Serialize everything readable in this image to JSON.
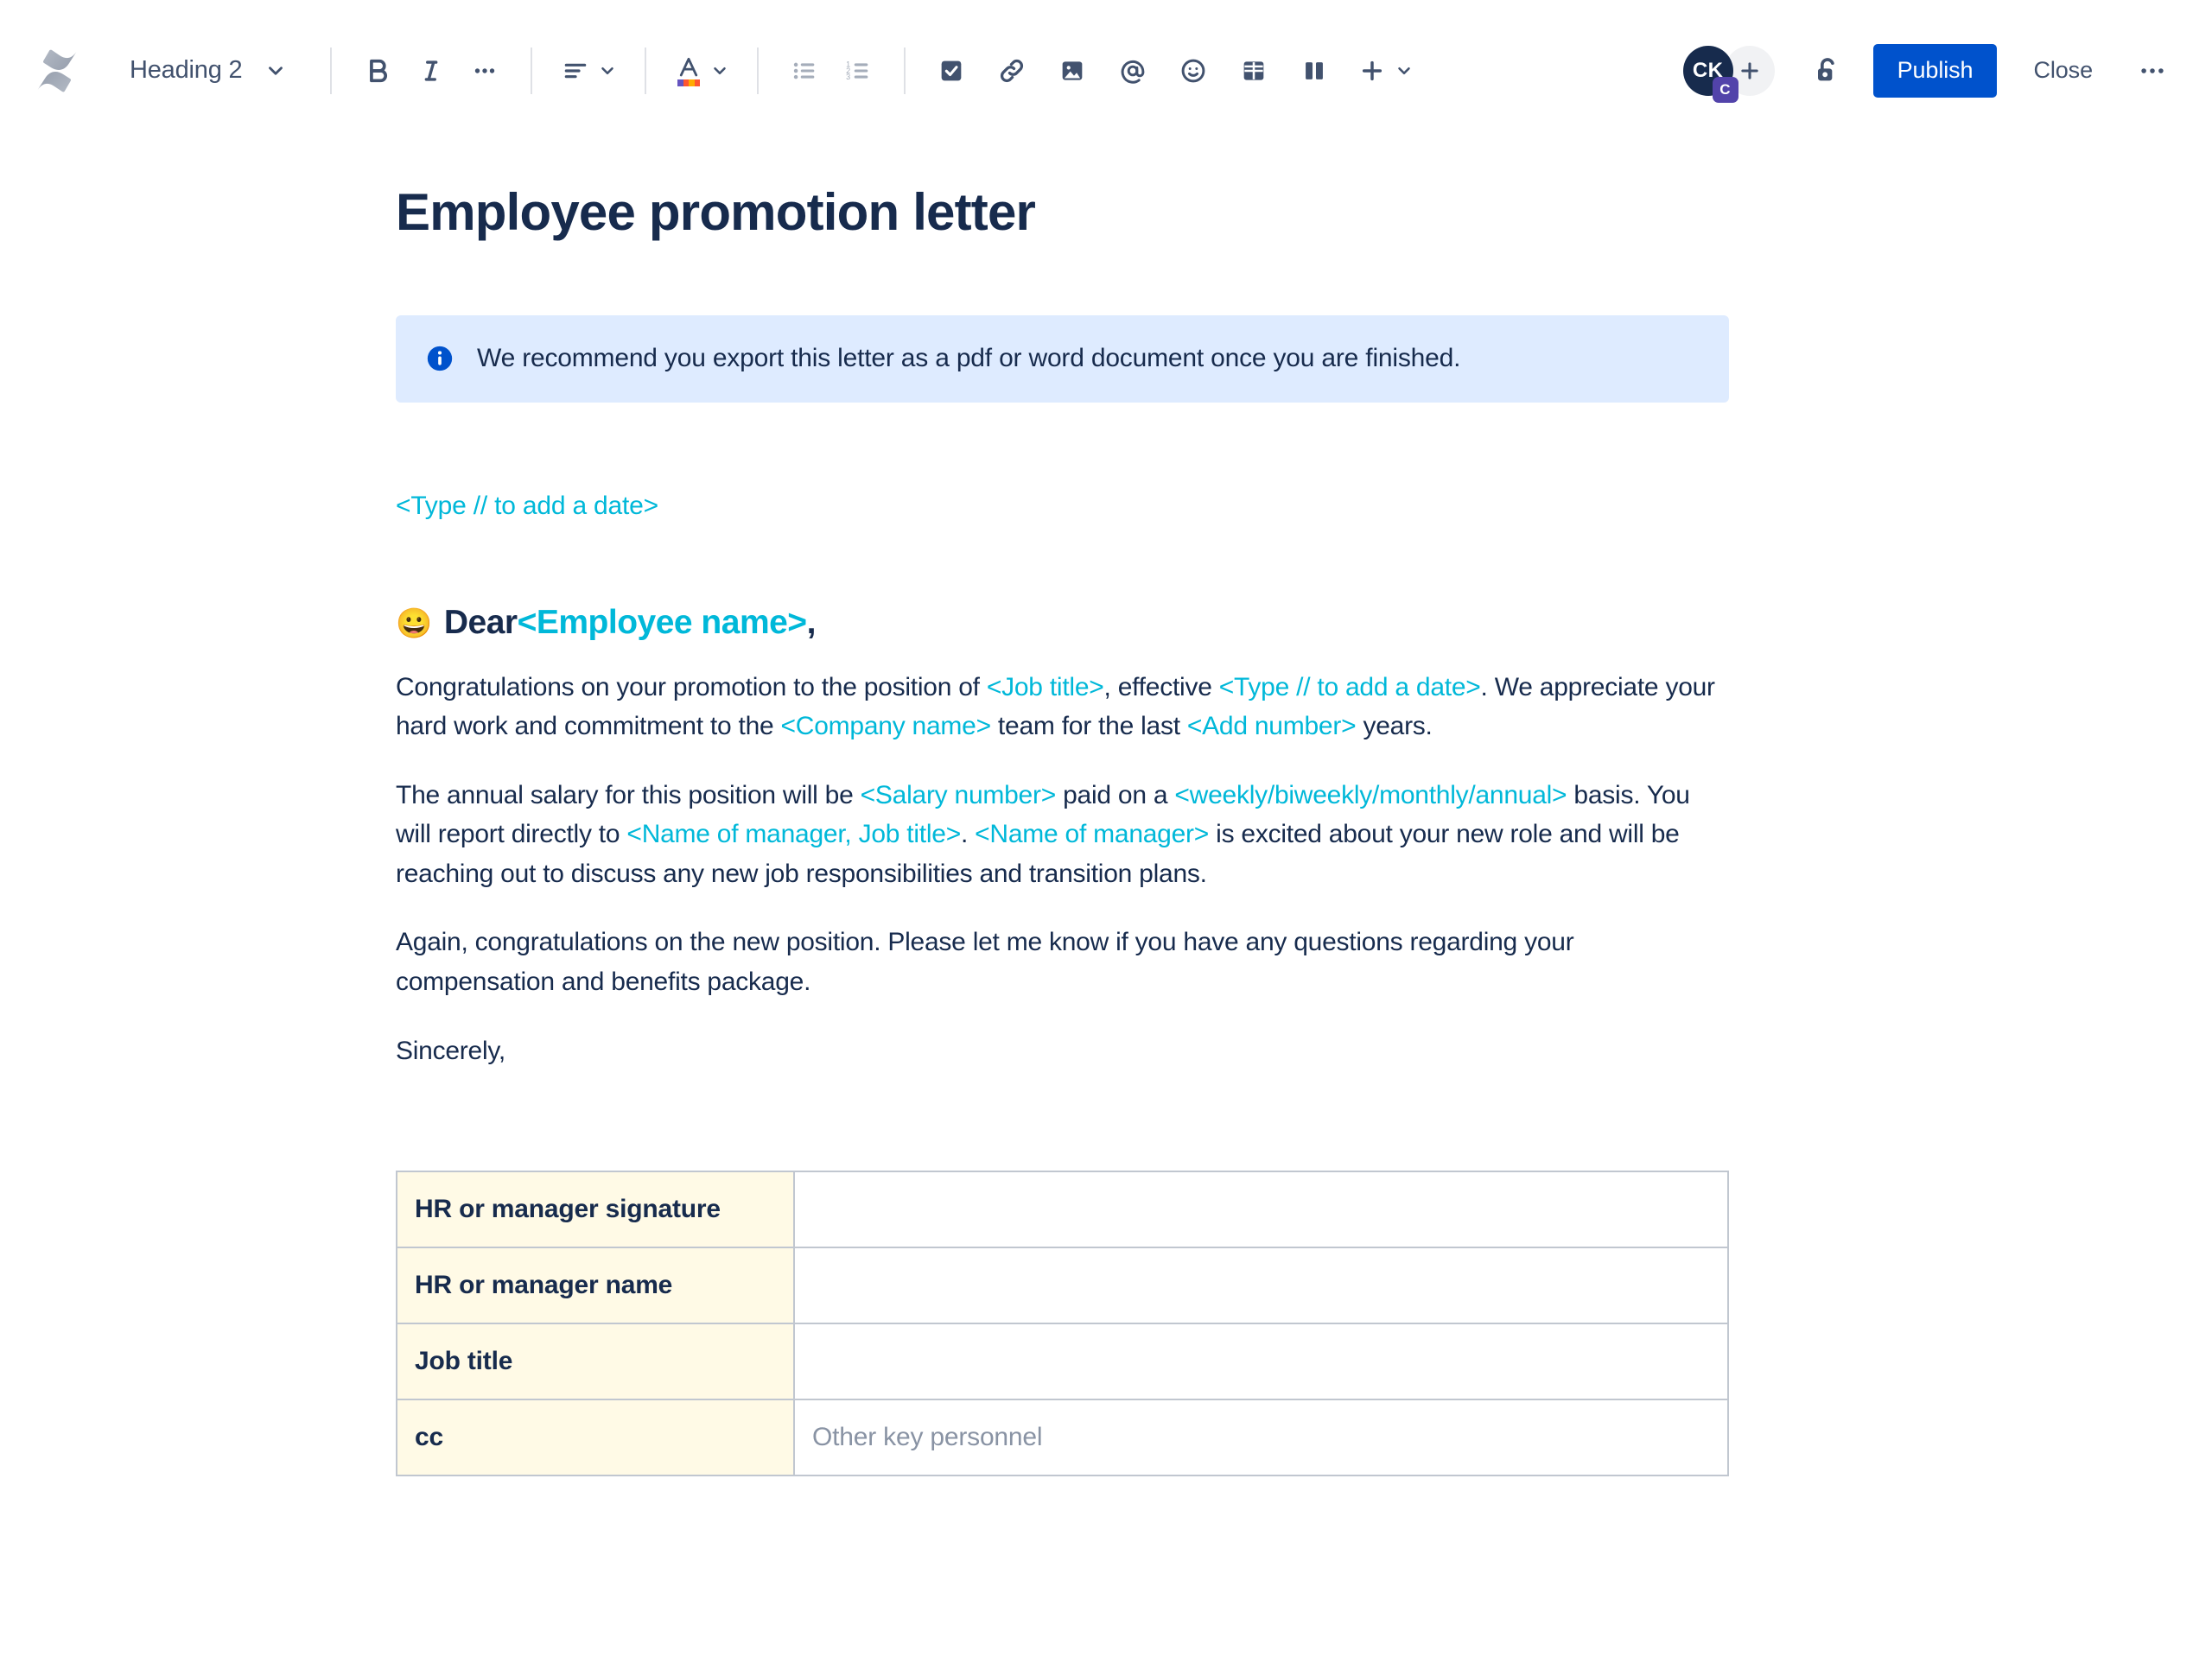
{
  "app": {
    "name": "Confluence",
    "logo_icon": "confluence-logo-icon"
  },
  "toolbar": {
    "block_type": {
      "label": "Heading 2",
      "chevron_icon": "chevron-down-icon"
    },
    "buttons": [
      {
        "name": "bold",
        "icon": "bold-icon",
        "label": "B"
      },
      {
        "name": "italic",
        "icon": "italic-icon",
        "label": "I"
      },
      {
        "name": "more-formatting",
        "icon": "ellipsis-icon",
        "label": "•••"
      },
      {
        "name": "text-align",
        "icon": "text-align-icon",
        "label": ""
      },
      {
        "name": "text-color",
        "icon": "text-color-icon",
        "label": "A"
      },
      {
        "name": "bulleted-list",
        "icon": "bulleted-list-icon",
        "label": ""
      },
      {
        "name": "numbered-list",
        "icon": "numbered-list-icon",
        "label": ""
      },
      {
        "name": "task-list",
        "icon": "checkbox-icon",
        "label": ""
      },
      {
        "name": "link",
        "icon": "link-icon",
        "label": ""
      },
      {
        "name": "image",
        "icon": "image-icon",
        "label": ""
      },
      {
        "name": "mention",
        "icon": "mention-at-icon",
        "label": "@"
      },
      {
        "name": "emoji",
        "icon": "emoji-smiley-icon",
        "label": ""
      },
      {
        "name": "table",
        "icon": "table-icon",
        "label": ""
      },
      {
        "name": "layout",
        "icon": "two-column-layout-icon",
        "label": ""
      },
      {
        "name": "insert-more",
        "icon": "plus-icon",
        "label": "+"
      }
    ],
    "avatar": {
      "initials": "CK",
      "badge": "C",
      "add_icon": "plus-icon"
    },
    "restrictions_icon": "unlocked-padlock-icon",
    "publish_label": "Publish",
    "close_label": "Close",
    "more_actions_icon": "ellipsis-icon",
    "more_actions_label": "•••"
  },
  "colors": {
    "accent_blue": "#0052CC",
    "placeholder_teal": "#00B8D9",
    "info_panel_bg": "#DEEBFF",
    "table_header_bg": "#FFFAE6",
    "text_navy": "#172B4D",
    "muted_gray": "#8993A4",
    "avatar_navy": "#172B4D",
    "badge_purple": "#5243AA"
  },
  "document": {
    "title": "Employee promotion letter",
    "info_panel": {
      "icon": "info-circle-icon",
      "text": "We recommend you export this letter as a pdf or word document once you are finished."
    },
    "date_placeholder": "<Type // to add a date>",
    "greeting": {
      "emoji": "😀",
      "prefix": "Dear ",
      "placeholder": "<Employee name>",
      "suffix": ","
    },
    "paragraphs": [
      {
        "name": "paragraph-congratulations",
        "segments": [
          {
            "text": "Congratulations on your promotion to the position of ",
            "type": "plain"
          },
          {
            "text": "<Job title>",
            "type": "placeholder"
          },
          {
            "text": ", effective ",
            "type": "plain"
          },
          {
            "text": "<Type // to add a date>",
            "type": "placeholder"
          },
          {
            "text": ". We appreciate your hard work and commitment to the ",
            "type": "plain"
          },
          {
            "text": "<Company name>",
            "type": "placeholder"
          },
          {
            "text": " team for the last ",
            "type": "plain"
          },
          {
            "text": "<Add number>",
            "type": "placeholder"
          },
          {
            "text": " years.",
            "type": "plain"
          }
        ]
      },
      {
        "name": "paragraph-salary",
        "segments": [
          {
            "text": "The annual salary for this position will be ",
            "type": "plain"
          },
          {
            "text": "<Salary number>",
            "type": "placeholder"
          },
          {
            "text": " paid on a ",
            "type": "plain"
          },
          {
            "text": "<weekly/biweekly/monthly/annual>",
            "type": "placeholder"
          },
          {
            "text": " basis. You will report directly to ",
            "type": "plain"
          },
          {
            "text": "<Name of manager, Job title>",
            "type": "placeholder"
          },
          {
            "text": ". ",
            "type": "plain"
          },
          {
            "text": "<Name of manager>",
            "type": "placeholder"
          },
          {
            "text": " is excited about your new role and will be reaching out to discuss any new job responsibilities and transition plans.",
            "type": "plain"
          }
        ]
      },
      {
        "name": "paragraph-closing",
        "segments": [
          {
            "text": "Again, congratulations on the new position. Please let me know if you have any questions regarding your compensation and benefits package.",
            "type": "plain"
          }
        ]
      },
      {
        "name": "paragraph-signoff",
        "segments": [
          {
            "text": "Sincerely,",
            "type": "plain"
          }
        ]
      }
    ],
    "signature_table": {
      "rows": [
        {
          "label": "HR or manager signature",
          "value": "",
          "placeholder": ""
        },
        {
          "label": "HR or manager name",
          "value": "",
          "placeholder": ""
        },
        {
          "label": "Job title",
          "value": "",
          "placeholder": ""
        },
        {
          "label": "cc",
          "value": "",
          "placeholder": "Other key personnel"
        }
      ]
    }
  }
}
